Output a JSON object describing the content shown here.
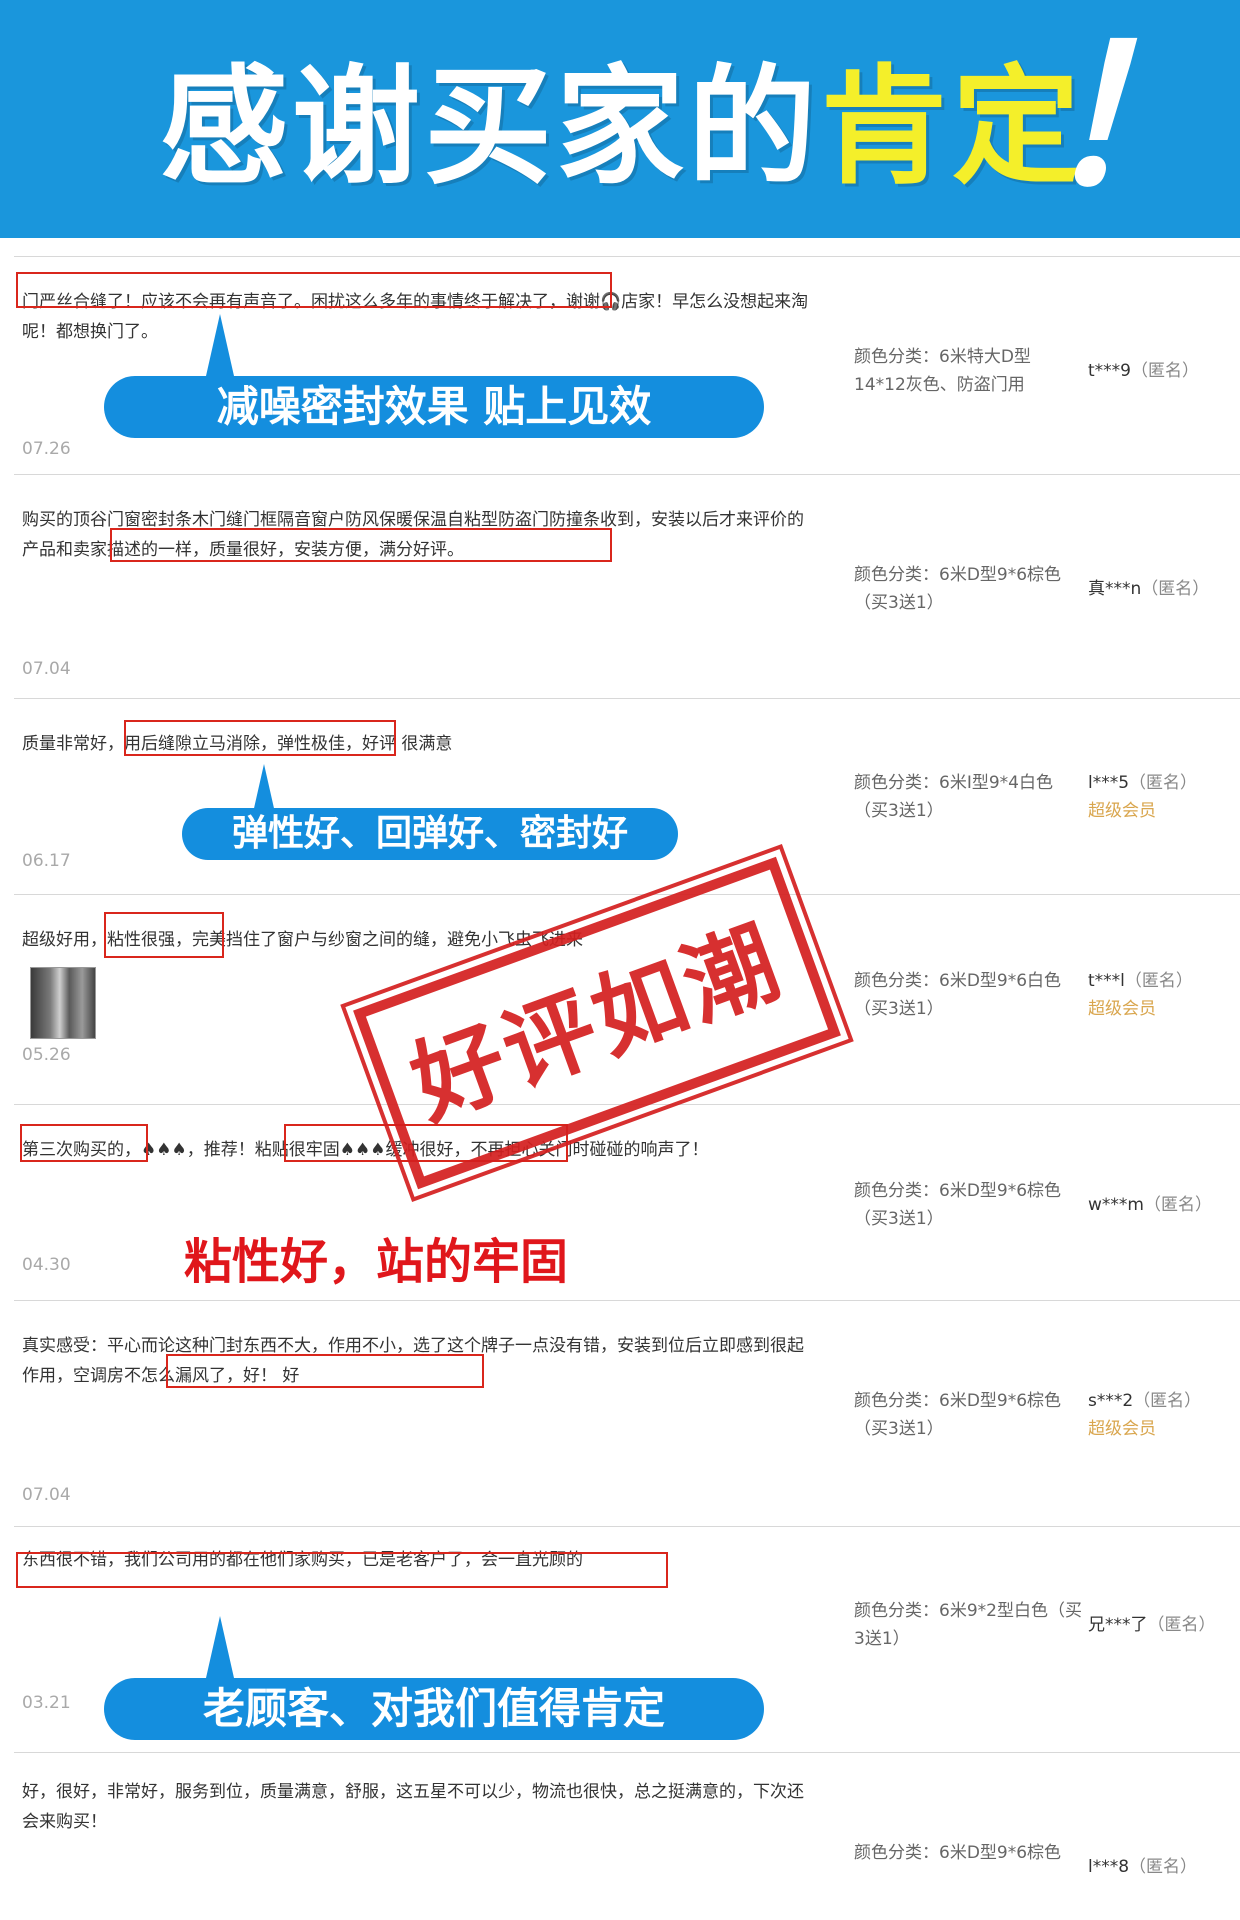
{
  "banner": {
    "title_main": "感谢买家的",
    "title_highlight": "肯定",
    "exclaim": "！"
  },
  "reviews": [
    {
      "text": "门严丝合缝了！应该不会再有声音了。困扰这么多年的事情终于解决了，谢谢🎧店家！早怎么没想起来淘呢！都想换门了。",
      "date": "07.26",
      "spec": "颜色分类：6米特大D型 14*12灰色、防盗门用",
      "user": "t***9",
      "anon": "（匿名）",
      "vip": ""
    },
    {
      "text": "购买的顶谷门窗密封条木门缝门框隔音窗户防风保暖保温自粘型防盗门防撞条收到，安装以后才来评价的产品和卖家描述的一样，质量很好，安装方便，满分好评。",
      "date": "07.04",
      "spec": "颜色分类：6米D型9*6棕色（买3送1）",
      "user": "真***n",
      "anon": "（匿名）",
      "vip": ""
    },
    {
      "text": "质量非常好，用后缝隙立马消除，弹性极佳，好评 很满意",
      "date": "06.17",
      "spec": "颜色分类：6米I型9*4白色（买3送1）",
      "user": "l***5",
      "anon": "（匿名）",
      "vip": "超级会员"
    },
    {
      "text": "超级好用，粘性很强，完美挡住了窗户与纱窗之间的缝，避免小飞虫飞进来",
      "date": "05.26",
      "spec": "颜色分类：6米D型9*6白色（买3送1）",
      "user": "t***l",
      "anon": "（匿名）",
      "vip": "超级会员"
    },
    {
      "text": "第三次购买的，♠♠♠，推荐！粘贴很牢固♠♠♠缓冲很好，不再担心关门时碰碰的响声了！",
      "date": "04.30",
      "spec": "颜色分类：6米D型9*6棕色（买3送1）",
      "user": "w***m",
      "anon": "（匿名）",
      "vip": ""
    },
    {
      "text": "真实感受：平心而论这种门封东西不大，作用不小，选了这个牌子一点没有错，安装到位后立即感到很起作用，空调房不怎么漏风了，好！ 好",
      "date": "07.04",
      "spec": "颜色分类：6米D型9*6棕色（买3送1）",
      "user": "s***2",
      "anon": "（匿名）",
      "vip": "超级会员"
    },
    {
      "text": "东西很不错，我们公司用的都在他们家购买，已是老客户了，会一直光顾的",
      "date": "03.21",
      "spec": "颜色分类：6米9*2型白色（买3送1）",
      "user": "兄***了",
      "anon": "（匿名）",
      "vip": ""
    },
    {
      "text": "好，很好，非常好，服务到位，质量满意，舒服，这五星不可以少，物流也很快，总之挺满意的，下次还会来购买！",
      "date": "",
      "spec": "颜色分类：6米D型9*6棕色",
      "user": "l***8",
      "anon": "（匿名）",
      "vip": ""
    }
  ],
  "callouts": {
    "c1": "减噪密封效果 贴上见效",
    "c2": "弹性好、回弹好、密封好",
    "c3": "老顾客、对我们值得肯定"
  },
  "caption_red": "粘性好，站的牢固",
  "stamp": "好评如潮",
  "colors": {
    "banner_blue": "#1a96dc",
    "highlight_yellow": "#f4ef2a",
    "callout_blue": "#148ede",
    "red": "#d9261c",
    "vip_gold": "#d9a64e"
  }
}
